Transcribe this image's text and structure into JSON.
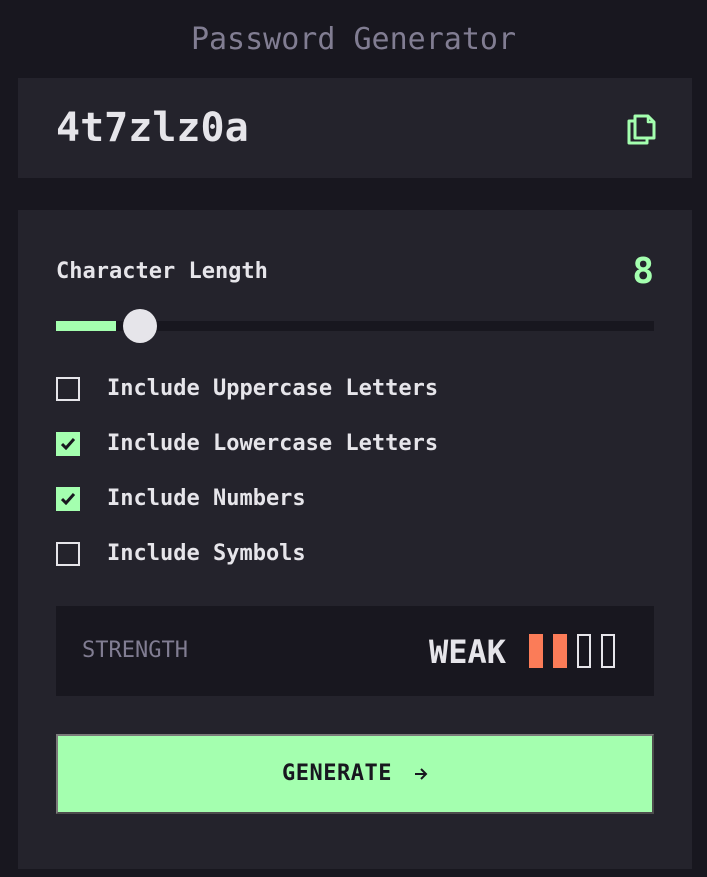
{
  "app": {
    "title": "Password Generator"
  },
  "output": {
    "password": "4t7zlz0a",
    "copy_icon": "copy-icon"
  },
  "length": {
    "label": "Character Length",
    "value": "8",
    "slider_fraction": 0.1
  },
  "options": [
    {
      "label": "Include Uppercase Letters",
      "checked": false
    },
    {
      "label": "Include Lowercase Letters",
      "checked": true
    },
    {
      "label": "Include Numbers",
      "checked": true
    },
    {
      "label": "Include Symbols",
      "checked": false
    }
  ],
  "strength": {
    "label": "STRENGTH",
    "value": "WEAK",
    "level": 2,
    "max_level": 4
  },
  "generate": {
    "label": "GENERATE",
    "icon": "arrow-right-icon"
  },
  "colors": {
    "accent": "#a4ffaf",
    "weak": "#fb7c58",
    "background": "#18171f",
    "panel": "#24232c",
    "muted": "#817d92",
    "text": "#e6e5ea"
  }
}
